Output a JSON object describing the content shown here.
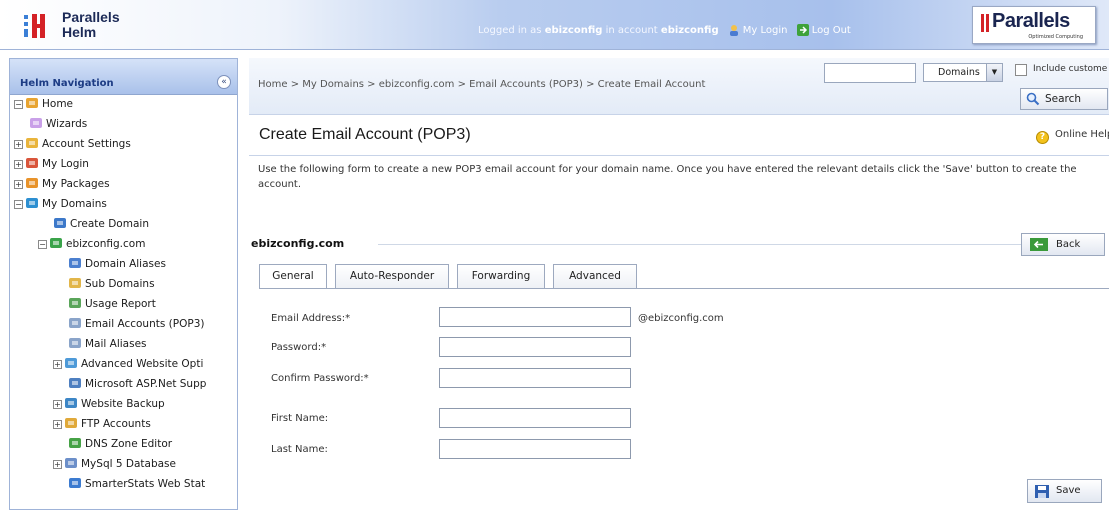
{
  "header": {
    "logo_text_line1": "Parallels",
    "logo_text_line2": "Helm",
    "logged_in_prefix": "Logged in as",
    "username": "ebizconfig",
    "in_account_text": "in account",
    "account": "ebizconfig",
    "my_login": "My Login",
    "log_out": "Log Out",
    "brand_name": "Parallels",
    "brand_tag": "Optimized Computing"
  },
  "sidebar": {
    "title": "Helm Navigation",
    "items": [
      {
        "label": "Home",
        "toggle": "−",
        "icon": "home-icon"
      },
      {
        "label": "Wizards",
        "icon": "wizard-icon"
      },
      {
        "label": "Account Settings",
        "toggle": "+",
        "icon": "folder-icon"
      },
      {
        "label": "My Login",
        "toggle": "+",
        "icon": "user-icon"
      },
      {
        "label": "My Packages",
        "toggle": "+",
        "icon": "package-icon"
      },
      {
        "label": "My Domains",
        "toggle": "−",
        "icon": "globe-icon"
      },
      {
        "label": "Create Domain",
        "icon": "add-icon"
      },
      {
        "label": "ebizconfig.com",
        "toggle": "−",
        "icon": "domain-icon"
      },
      {
        "label": "Domain Aliases",
        "icon": "alias-icon"
      },
      {
        "label": "Sub Domains",
        "icon": "subdomain-icon"
      },
      {
        "label": "Usage Report",
        "icon": "report-icon"
      },
      {
        "label": "Email Accounts (POP3)",
        "icon": "email-icon"
      },
      {
        "label": "Mail Aliases",
        "icon": "mail-alias-icon"
      },
      {
        "label": "Advanced Website Opti",
        "toggle": "+",
        "icon": "settings-icon"
      },
      {
        "label": "Microsoft ASP.Net Supp",
        "icon": "aspnet-icon"
      },
      {
        "label": "Website Backup",
        "toggle": "+",
        "icon": "backup-icon"
      },
      {
        "label": "FTP Accounts",
        "toggle": "+",
        "icon": "ftp-icon"
      },
      {
        "label": "DNS Zone Editor",
        "icon": "dns-icon"
      },
      {
        "label": "MySql 5 Database",
        "toggle": "+",
        "icon": "database-icon"
      },
      {
        "label": "SmarterStats Web Stat",
        "icon": "stats-icon"
      }
    ]
  },
  "breadcrumb": "Home > My Domains > ebizconfig.com > Email Accounts (POP3) > Create Email Account",
  "search": {
    "value": "",
    "scope": "Domains",
    "include_label": "Include custome",
    "button": "Search"
  },
  "page_title": "Create Email Account (POP3)",
  "online_help": "Online Help",
  "intro": "Use the following form to create a new POP3 email account for your domain name. Once you have entered the relevant details click the 'Save' button to create the account.",
  "domain": "ebizconfig.com",
  "back_button": "Back",
  "tabs": [
    {
      "label": "General",
      "active": true
    },
    {
      "label": "Auto-Responder",
      "active": false
    },
    {
      "label": "Forwarding",
      "active": false
    },
    {
      "label": "Advanced",
      "active": false
    }
  ],
  "form": {
    "email_label": "Email Address:*",
    "email_value": "",
    "email_suffix": "@ebizconfig.com",
    "password_label": "Password:*",
    "password_value": "",
    "confirm_label": "Confirm Password:*",
    "confirm_value": "",
    "first_name_label": "First Name:",
    "first_name_value": "",
    "last_name_label": "Last Name:",
    "last_name_value": ""
  },
  "save_button": "Save",
  "colors": {
    "header_blue": "#a7c0ec",
    "nav_title": "#1d3c84",
    "brand_red": "#d42226"
  }
}
